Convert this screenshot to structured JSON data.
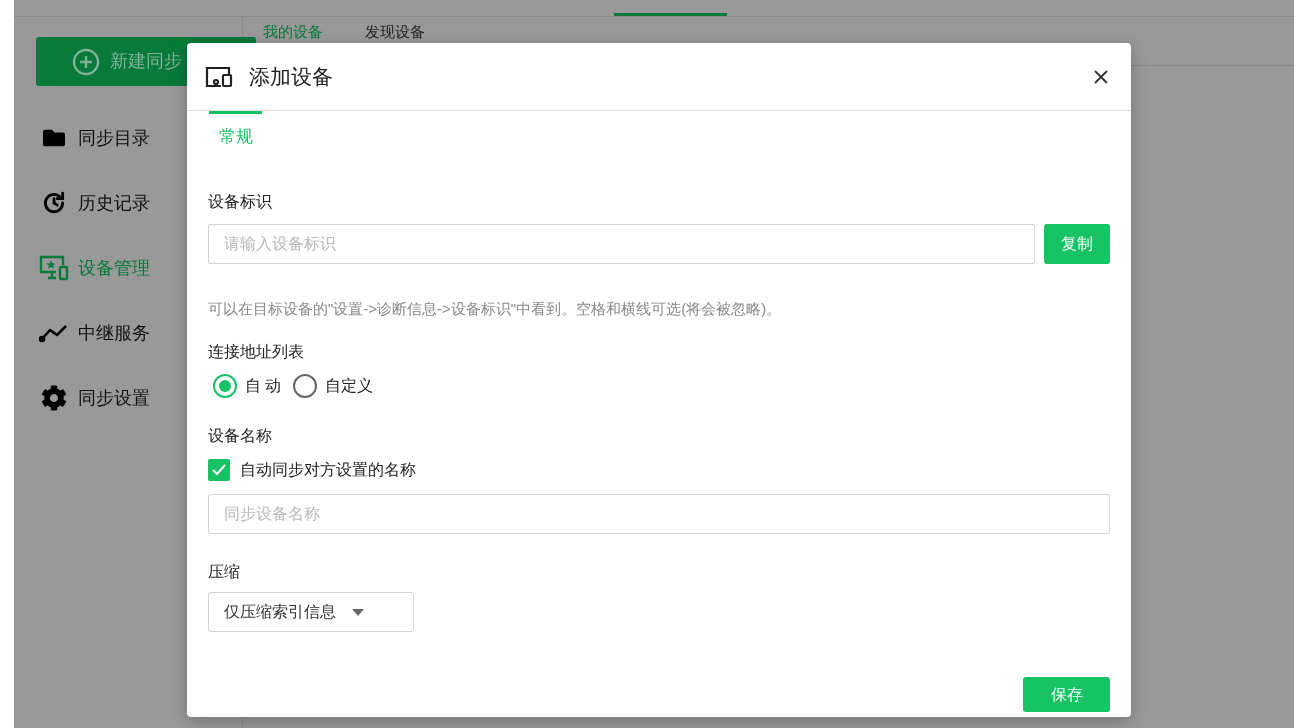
{
  "app": {
    "new_sync_button": "新建同步",
    "sidebar": {
      "items": [
        {
          "label": "同步目录",
          "kind": "folder",
          "selected": false
        },
        {
          "label": "历史记录",
          "kind": "history",
          "selected": false
        },
        {
          "label": "设备管理",
          "kind": "devices",
          "selected": true
        },
        {
          "label": "中继服务",
          "kind": "relay",
          "selected": false
        },
        {
          "label": "同步设置",
          "kind": "gear",
          "selected": false
        }
      ]
    },
    "device_tabs": [
      {
        "label": "我的设备",
        "selected": true
      },
      {
        "label": "发现设备",
        "selected": false
      }
    ]
  },
  "dialog": {
    "title": "添加设备",
    "tabs": [
      {
        "label": "常规",
        "selected": true
      }
    ],
    "device_id": {
      "label": "设备标识",
      "placeholder": "请输入设备标识",
      "button": "复制",
      "hint": "可以在目标设备的\"设置->诊断信息->设备标识\"中看到。空格和横线可选(将会被忽略)。"
    },
    "addresses": {
      "label": "连接地址列表",
      "options": [
        {
          "label": "自 动",
          "selected": true
        },
        {
          "label": "自定义",
          "selected": false
        }
      ]
    },
    "device_name": {
      "label": "设备名称",
      "checkbox": {
        "label": "自动同步对方设置的名称",
        "checked": true
      },
      "placeholder": "同步设备名称"
    },
    "compression": {
      "label": "压缩",
      "value": "仅压缩索引信息"
    },
    "save_button": "保存"
  }
}
